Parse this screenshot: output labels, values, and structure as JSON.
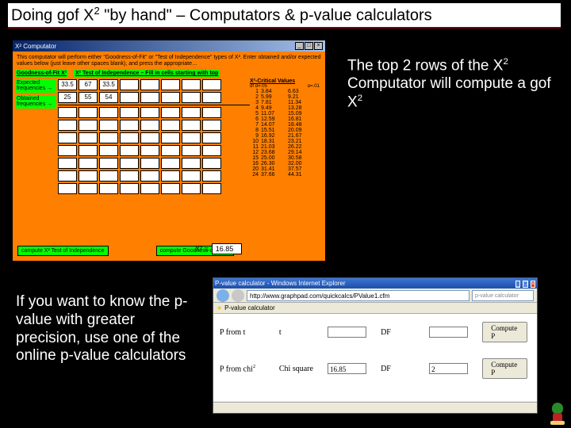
{
  "title_html": "Doing gof X<sup>2</sup> \"by hand\" – Computators & p-value calculators",
  "annotation_top_right": "The top 2 rows of the X<sup>2</sup> Computator will compute a gof X<sup>2</sup>",
  "annotation_bottom_left": "If you want to know the p-value with greater precision, use one of the online p-value calculators",
  "computator": {
    "window_title": "X² Computator",
    "instructions": "This computator will perform either \"Goodness-of-Fit\" or \"Test of Independence\" types of X². Enter obtained and/or expected values below (just leave other spaces blank), and press the appropriate…",
    "tab_gof": "Goodness-of-Fit X²",
    "tab_ind": "X² Test of Independence – Fill in cells starting with top",
    "row_label_expected": "Expected frequencies →",
    "row_label_obtained": "Obtained frequencies →",
    "grid_cols": 8,
    "expected_values": [
      "33.5",
      "67",
      "33.5",
      "",
      "",
      "",
      "",
      ""
    ],
    "obtained_values": [
      "25",
      "55",
      "54",
      "",
      "",
      "",
      "",
      ""
    ],
    "extra_blank_rows": 7,
    "btn_independence": "compute X² Test of Independence",
    "btn_gof": "compute Goodness-of-Fit X²",
    "result_label": "X² =",
    "result_value": "16.85",
    "crit_header": "X²-Critical Values",
    "crit_sub_left": "df α=.05",
    "crit_sub_right": "α=.01",
    "crit_rows": [
      {
        "df": "1",
        "a05": "3.84",
        "a01": "6.63"
      },
      {
        "df": "2",
        "a05": "5.99",
        "a01": "9.21"
      },
      {
        "df": "3",
        "a05": "7.81",
        "a01": "11.34"
      },
      {
        "df": "4",
        "a05": "9.49",
        "a01": "13.28"
      },
      {
        "df": "5",
        "a05": "11.07",
        "a01": "15.09"
      },
      {
        "df": "6",
        "a05": "12.59",
        "a01": "16.81"
      },
      {
        "df": "7",
        "a05": "14.07",
        "a01": "18.48"
      },
      {
        "df": "8",
        "a05": "15.51",
        "a01": "20.09"
      },
      {
        "df": "9",
        "a05": "16.92",
        "a01": "21.67"
      },
      {
        "df": "10",
        "a05": "18.31",
        "a01": "23.21"
      },
      {
        "df": "11",
        "a05": "21.03",
        "a01": "26.22"
      },
      {
        "df": "12",
        "a05": "23.68",
        "a01": "29.14"
      },
      {
        "df": "15",
        "a05": "25.00",
        "a01": "30.58"
      },
      {
        "df": "16",
        "a05": "26.30",
        "a01": "32.00"
      },
      {
        "df": "20",
        "a05": "31.41",
        "a01": "37.57"
      },
      {
        "df": "24",
        "a05": "37.66",
        "a01": "44.31"
      }
    ]
  },
  "browser": {
    "window_title": "P-value calculator - Windows Internet Explorer",
    "url": "http://www.graphpad.com/quickcalcs/PValue1.cfm",
    "search_placeholder": "p-value calculator",
    "bookmark": "P-value calculator",
    "row1": {
      "label": "P from t",
      "sub": "t",
      "val": "",
      "df_lbl": "DF",
      "df_val": "",
      "btn": "Compute P"
    },
    "row2": {
      "label_html": "P from chi<sup>2</sup>",
      "sub": "Chi square",
      "val": "16.85",
      "df_lbl": "DF",
      "df_val": "2",
      "btn": "Compute P"
    }
  }
}
